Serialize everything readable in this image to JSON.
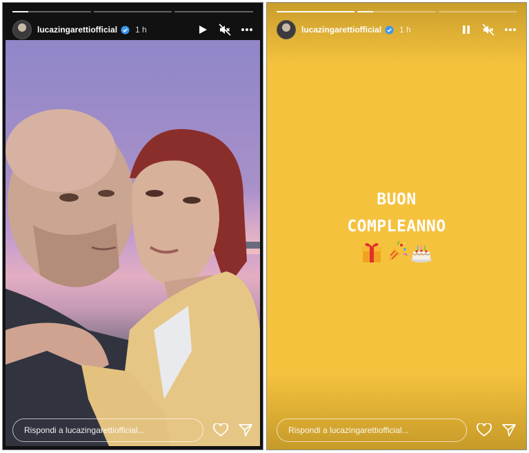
{
  "stories": {
    "left": {
      "progress": [
        0.2,
        0,
        0
      ],
      "username": "lucazingarettiofficial",
      "time": "1 h",
      "reply_placeholder": "Rispondi a lucazingarettiofficial...",
      "controls": [
        "play-icon",
        "mute-icon",
        "more-icon"
      ]
    },
    "right": {
      "progress": [
        1,
        0.2,
        0
      ],
      "username": "lucazingarettiofficial",
      "time": "1 h",
      "reply_placeholder": "Rispondi a lucazingarettiofficial...",
      "controls": [
        "pause-icon",
        "mute-icon",
        "more-icon"
      ],
      "greeting_line1": "BUON",
      "greeting_line2": "COMPLEANNO",
      "emojis": [
        "gift-icon",
        "party-popper-icon",
        "birthday-cake-icon"
      ],
      "background_color": "#f5c23e"
    }
  },
  "colors": {
    "verified_blue": "#3897f0",
    "text_white": "#ffffff"
  }
}
